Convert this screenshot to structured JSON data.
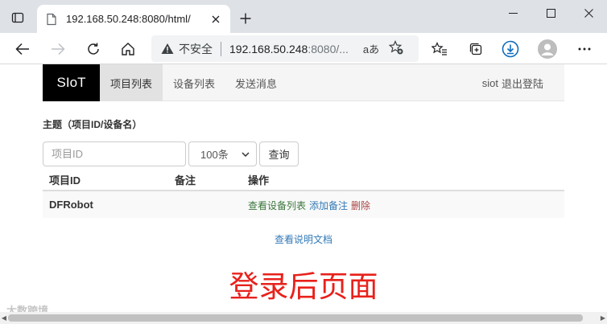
{
  "browser": {
    "tab": {
      "title": "192.168.50.248:8080/html/"
    },
    "address": {
      "security_label": "不安全",
      "url_host": "192.168.50.248",
      "url_rest": ":8080/...",
      "read_aloud_glyph": "aあ"
    }
  },
  "navbar": {
    "brand": "SIoT",
    "items": [
      {
        "label": "项目列表",
        "active": true
      },
      {
        "label": "设备列表",
        "active": false
      },
      {
        "label": "发送消息",
        "active": false
      }
    ],
    "user": "siot",
    "logout": "退出登陆"
  },
  "section_title": "主题（项目ID/设备名）",
  "filter": {
    "project_id_placeholder": "项目ID",
    "count_selected": "100条",
    "query_label": "查询"
  },
  "table": {
    "headers": [
      "项目ID",
      "备注",
      "操作"
    ],
    "rows": [
      {
        "project_id": "DFRobot",
        "note": "",
        "actions": {
          "view_devices": "查看设备列表",
          "add_note": "添加备注",
          "delete": "删除"
        }
      }
    ]
  },
  "doc_link": "查看说明文档",
  "caption": "登录后页面",
  "watermark": "大数跨境",
  "colors": {
    "brand_bg": "#000000",
    "caption": "#e8211b",
    "link_blue": "#337ab7",
    "link_green": "#3c763d",
    "link_red": "#a94442"
  }
}
